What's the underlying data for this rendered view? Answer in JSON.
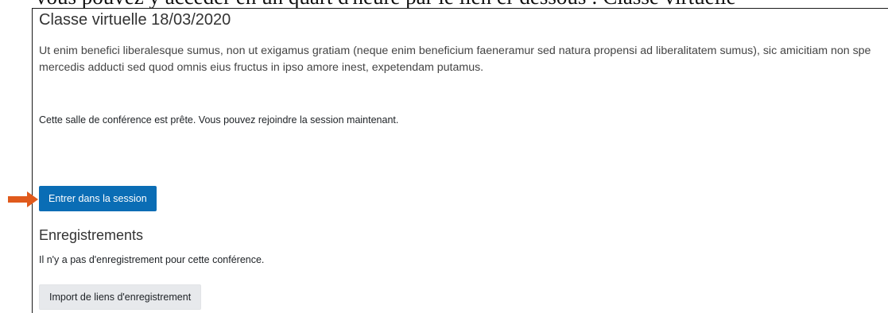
{
  "caption": {
    "text": "vous pouvez y accéder en un quart d'heure par le lien ci-dessous : Classe virtuelle"
  },
  "activity": {
    "title": "Classe virtuelle 18/03/2020",
    "description": "Ut enim benefici liberalesque sumus, non ut exigamus gratiam (neque enim beneficium faeneramur sed natura propensi ad liberalitatem sumus), sic amicitiam non spe mercedis adducti sed quod omnis eius fructus in ipso amore inest, expetendam putamus.",
    "status_message": "Cette salle de conférence est prête. Vous pouvez rejoindre la session maintenant.",
    "join_button_label": "Entrer dans la session"
  },
  "recordings": {
    "heading": "Enregistrements",
    "empty_message": "Il n'y a pas d'enregistrement pour cette conférence.",
    "import_button_label": "Import de liens d'enregistrement"
  },
  "colors": {
    "primary_button": "#0a6db5",
    "secondary_button": "#e7e9ec",
    "annotation_arrow": "#e05a1c"
  },
  "icons": {
    "annotation": "arrow-right-icon"
  }
}
